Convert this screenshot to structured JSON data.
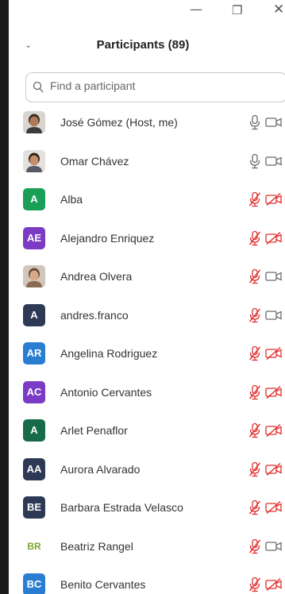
{
  "window": {
    "minimize_glyph": "—",
    "maximize_glyph": "❐",
    "close_glyph": "✕"
  },
  "header": {
    "title": "Participants (89)",
    "collapse_glyph": "⌄"
  },
  "search": {
    "placeholder": "Find a participant"
  },
  "colors": {
    "muted_red": "#e02d2d",
    "icon_grey": "#6b6b6b",
    "green": "#1b9f56",
    "purple": "#7b3bc4",
    "navy": "#2e3a55",
    "blue": "#2a7ed2",
    "dark_green": "#176b4a"
  },
  "participants": [
    {
      "name": "José Gómez (Host, me)",
      "avatar": {
        "type": "photo",
        "initials": ""
      },
      "mic": "on",
      "camera": "on"
    },
    {
      "name": "Omar Chávez",
      "avatar": {
        "type": "photo",
        "initials": ""
      },
      "mic": "on",
      "camera": "on"
    },
    {
      "name": "Alba",
      "avatar": {
        "type": "initials",
        "initials": "A",
        "color": "#1b9f56"
      },
      "mic": "muted",
      "camera": "off"
    },
    {
      "name": "Alejandro Enriquez",
      "avatar": {
        "type": "initials",
        "initials": "AE",
        "color": "#7b3bc4"
      },
      "mic": "muted",
      "camera": "off"
    },
    {
      "name": "Andrea Olvera",
      "avatar": {
        "type": "photo",
        "initials": ""
      },
      "mic": "muted",
      "camera": "on"
    },
    {
      "name": "andres.franco",
      "avatar": {
        "type": "initials",
        "initials": "A",
        "color": "#2e3a55"
      },
      "mic": "muted",
      "camera": "on"
    },
    {
      "name": "Angelina Rodriguez",
      "avatar": {
        "type": "initials",
        "initials": "AR",
        "color": "#2a7ed2"
      },
      "mic": "muted",
      "camera": "off"
    },
    {
      "name": "Antonio Cervantes",
      "avatar": {
        "type": "initials",
        "initials": "AC",
        "color": "#7b3bc4"
      },
      "mic": "muted",
      "camera": "off"
    },
    {
      "name": "Arlet Penaflor",
      "avatar": {
        "type": "initials",
        "initials": "A",
        "color": "#176b4a"
      },
      "mic": "muted",
      "camera": "off"
    },
    {
      "name": "Aurora Alvarado",
      "avatar": {
        "type": "initials",
        "initials": "AA",
        "color": "#2e3a55"
      },
      "mic": "muted",
      "camera": "off"
    },
    {
      "name": "Barbara Estrada Velasco",
      "avatar": {
        "type": "initials",
        "initials": "BE",
        "color": "#2e3a55"
      },
      "mic": "muted",
      "camera": "off"
    },
    {
      "name": "Beatriz Rangel",
      "avatar": {
        "type": "plain",
        "initials": "BR",
        "color": "#7aa82a"
      },
      "mic": "muted",
      "camera": "on"
    },
    {
      "name": "Benito Cervantes",
      "avatar": {
        "type": "initials",
        "initials": "BC",
        "color": "#2a7ed2"
      },
      "mic": "muted",
      "camera": "off"
    }
  ]
}
